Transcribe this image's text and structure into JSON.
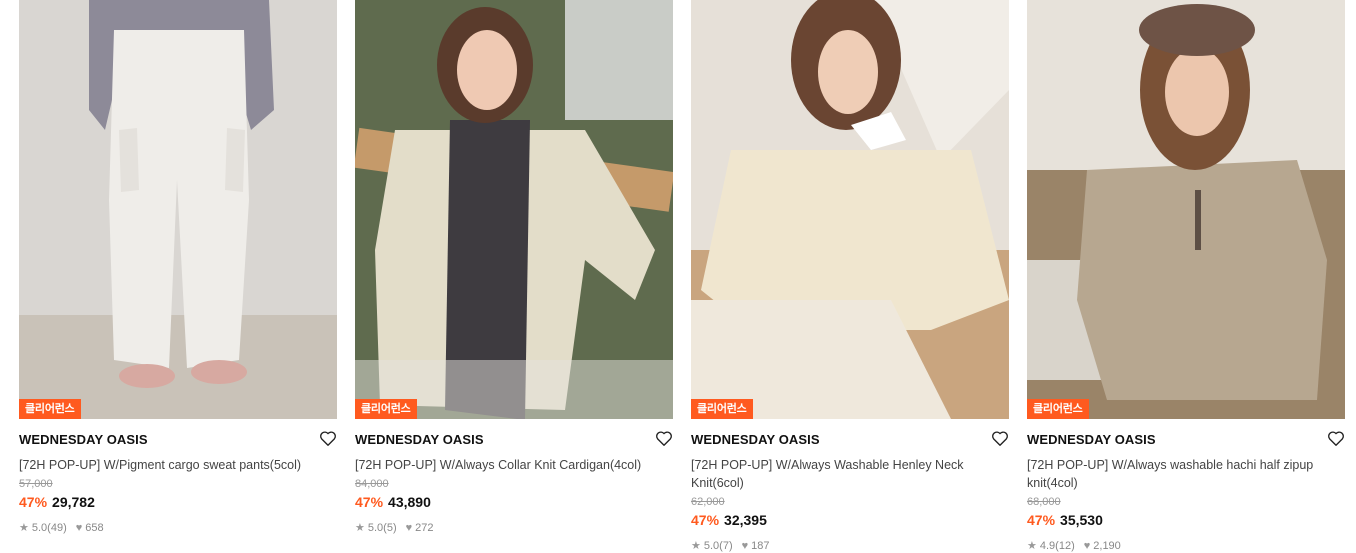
{
  "products": [
    {
      "badge": "클리어런스",
      "brand": "WEDNESDAY OASIS",
      "name": "[72H POP-UP] W/Pigment cargo sweat pants(5col)",
      "original_price": "57,000",
      "discount": "47%",
      "price": "29,782",
      "rating": "5.0",
      "reviews": "(49)",
      "likes": "658"
    },
    {
      "badge": "클리어런스",
      "brand": "WEDNESDAY OASIS",
      "name": "[72H POP-UP] W/Always Collar Knit Cardigan(4col)",
      "original_price": "84,000",
      "discount": "47%",
      "price": "43,890",
      "rating": "5.0",
      "reviews": "(5)",
      "likes": "272"
    },
    {
      "badge": "클리어런스",
      "brand": "WEDNESDAY OASIS",
      "name": "[72H POP-UP] W/Always Washable Henley Neck Knit(6col)",
      "original_price": "62,000",
      "discount": "47%",
      "price": "32,395",
      "rating": "5.0",
      "reviews": "(7)",
      "likes": "187"
    },
    {
      "badge": "클리어런스",
      "brand": "WEDNESDAY OASIS",
      "name": "[72H POP-UP] W/Always washable hachi half zipup knit(4col)",
      "original_price": "68,000",
      "discount": "47%",
      "price": "35,530",
      "rating": "4.9",
      "reviews": "(12)",
      "likes": "2,190"
    }
  ],
  "colors": {
    "accent": "#ff5a1f",
    "muted": "#999999"
  },
  "icons": {
    "wishlist": "heart-outline-icon",
    "rating": "star-icon",
    "likes": "heart-filled-icon"
  }
}
